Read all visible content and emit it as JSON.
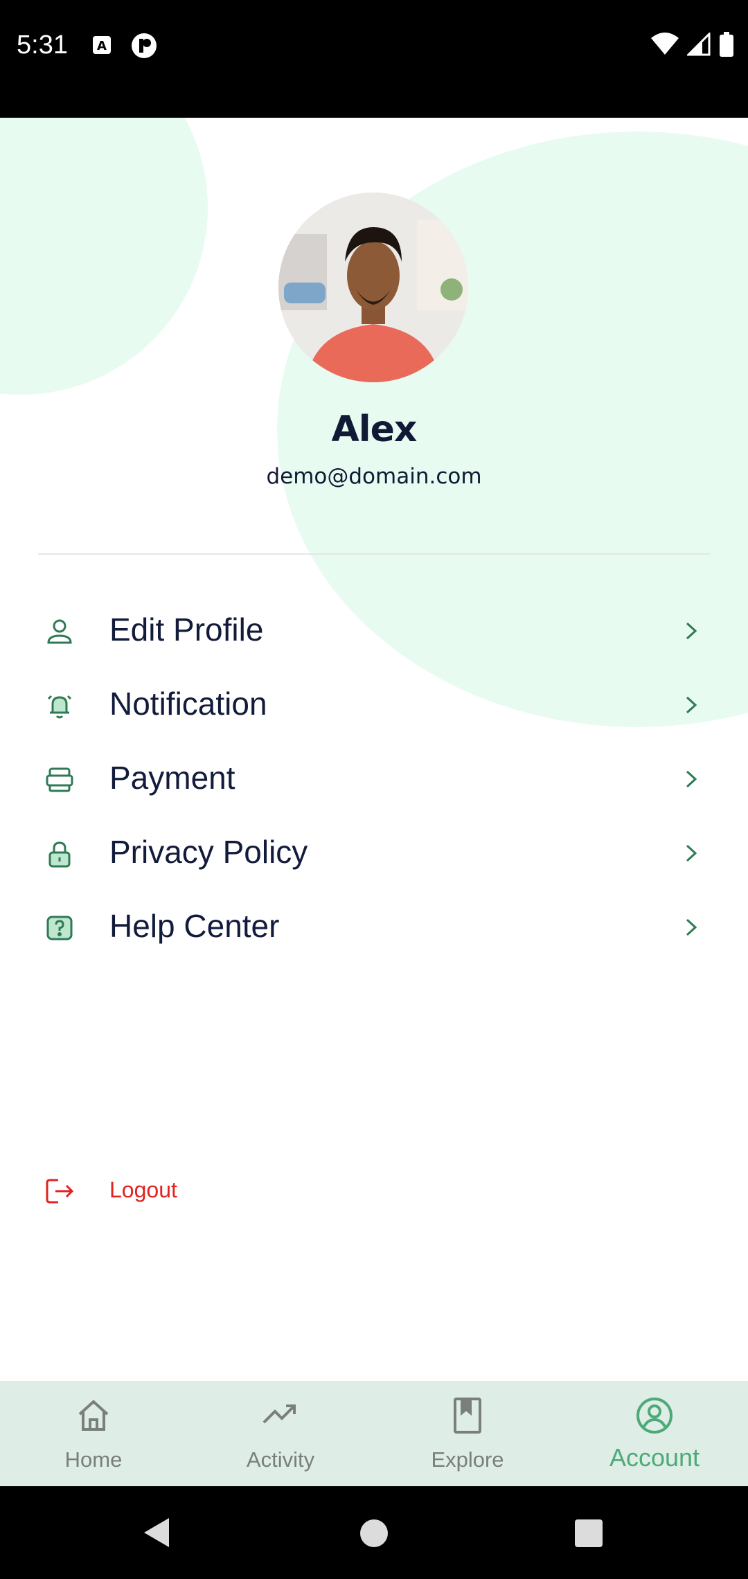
{
  "status_bar": {
    "time": "5:31",
    "icons": [
      "a-notification-icon",
      "app-notification-icon",
      "wifi-icon",
      "cellular-icon",
      "battery-icon"
    ]
  },
  "profile": {
    "name": "Alex",
    "email": "demo@domain.com"
  },
  "menu": {
    "items": [
      {
        "label": "Edit Profile",
        "icon": "user-icon"
      },
      {
        "label": "Notification",
        "icon": "bell-icon"
      },
      {
        "label": "Payment",
        "icon": "wallet-icon"
      },
      {
        "label": "Privacy Policy",
        "icon": "lock-icon"
      },
      {
        "label": "Help Center",
        "icon": "help-icon"
      }
    ],
    "logout_label": "Logout"
  },
  "bottom_nav": {
    "items": [
      {
        "label": "Home",
        "icon": "home-icon",
        "active": false
      },
      {
        "label": "Activity",
        "icon": "trending-up-icon",
        "active": false
      },
      {
        "label": "Explore",
        "icon": "bookmark-book-icon",
        "active": false
      },
      {
        "label": "Account",
        "icon": "account-circle-icon",
        "active": true
      }
    ]
  },
  "colors": {
    "accent": "#4daa78",
    "icon_green": "#2f7a55",
    "blob": "#e8fbf1",
    "logout_red": "#e2231f",
    "text_dark": "#121b3b",
    "nav_bg": "#deede5"
  }
}
